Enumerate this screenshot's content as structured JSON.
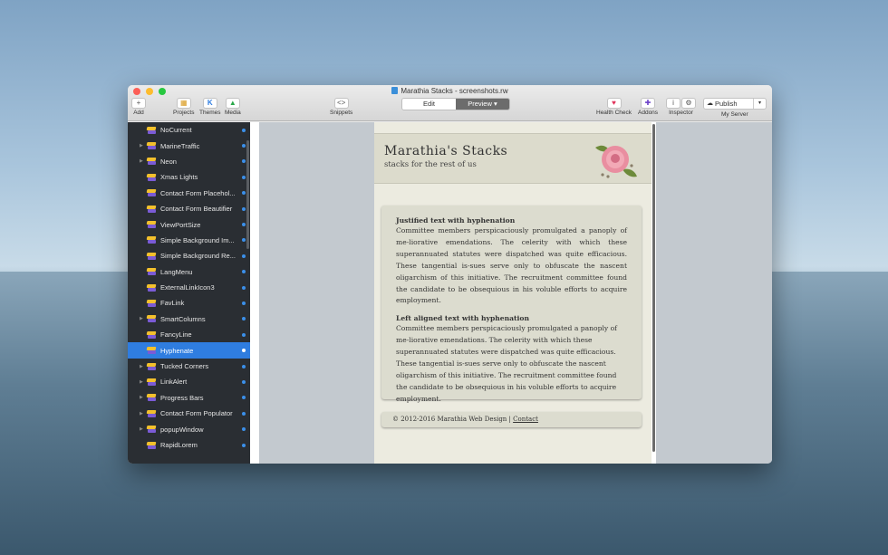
{
  "window": {
    "title": "Marathia Stacks - screenshots.rw"
  },
  "toolbar": {
    "add": "Add",
    "projects": "Projects",
    "themes": "Themes",
    "media": "Media",
    "snippets": "Snippets",
    "edit": "Edit",
    "preview": "Preview",
    "health_check": "Health Check",
    "addons": "Addons",
    "inspector": "Inspector",
    "publish": "Publish",
    "server": "My Server"
  },
  "sidebar": {
    "items": [
      {
        "label": "NoCurrent",
        "disclosure": false
      },
      {
        "label": "MarineTraffic",
        "disclosure": true
      },
      {
        "label": "Neon",
        "disclosure": true
      },
      {
        "label": "Xmas Lights",
        "disclosure": false
      },
      {
        "label": "Contact Form Placehol...",
        "disclosure": false
      },
      {
        "label": "Contact Form Beautifier",
        "disclosure": false
      },
      {
        "label": "ViewPortSize",
        "disclosure": false
      },
      {
        "label": "Simple Background Im...",
        "disclosure": false
      },
      {
        "label": "Simple Background Re...",
        "disclosure": false
      },
      {
        "label": "LangMenu",
        "disclosure": false
      },
      {
        "label": "ExternalLinkIcon3",
        "disclosure": false
      },
      {
        "label": "FavLink",
        "disclosure": false
      },
      {
        "label": "SmartColumns",
        "disclosure": true
      },
      {
        "label": "FancyLine",
        "disclosure": false
      },
      {
        "label": "Hyphenate",
        "disclosure": false,
        "selected": true
      },
      {
        "label": "Tucked Corners",
        "disclosure": true
      },
      {
        "label": "LinkAlert",
        "disclosure": true
      },
      {
        "label": "Progress Bars",
        "disclosure": true
      },
      {
        "label": "Contact Form Populator",
        "disclosure": true
      },
      {
        "label": "popupWindow",
        "disclosure": true
      },
      {
        "label": "RapidLorem",
        "disclosure": false
      }
    ]
  },
  "site": {
    "title": "Marathia's Stacks",
    "subtitle": "stacks for the rest of us",
    "section1_heading": "Justified text with hyphenation",
    "section1_text": "Committee members perspicaciously promulgated a panoply of me-liorative emendations. The celerity with which these superannuated statutes were dispatched was quite efficacious. These tangential is-sues serve only to obfuscate the nascent oligarchism of this initiative. The recruitment committee found the candidate to be obsequious in his voluble efforts to acquire employment.",
    "section2_heading": "Left aligned text with hyphenation",
    "section2_text": "Committee members perspicaciously promulgated a panoply of me-liorative emendations. The celerity with which these superannuated statutes were dispatched was quite efficacious. These tangential is-sues serve only to obfuscate the nascent oligarchism of this initiative. The recruitment committee found the candidate to be obsequious in his voluble efforts to acquire employment.",
    "footer_text": "© 2012-2016 Marathia Web Design | ",
    "footer_link": "Contact"
  },
  "colors": {
    "accent": "#2f7de0",
    "sidebar_bg": "#2a2e33",
    "dot": "#3b8fe9"
  }
}
